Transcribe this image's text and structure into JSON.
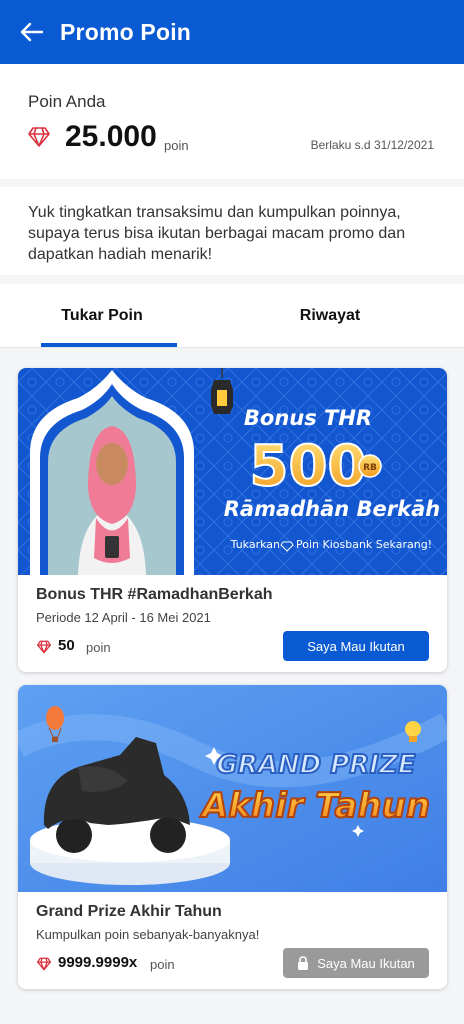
{
  "header": {
    "title": "Promo Poin",
    "back_icon": "arrow-left-icon"
  },
  "points": {
    "label": "Poin Anda",
    "value": "25.000",
    "unit": "poin",
    "expiry": "Berlaku s.d 31/12/2021",
    "gem_icon": "diamond-icon"
  },
  "info": {
    "text": "Yuk tingkatkan transaksimu dan kumpulkan poinnya, supaya terus bisa ikutan berbagai macam promo dan dapatkan hadiah menarik!"
  },
  "tabs": [
    {
      "label": "Tukar Poin",
      "active": true
    },
    {
      "label": "Riwayat",
      "active": false
    }
  ],
  "promos": [
    {
      "banner": {
        "headline": "Bonus THR",
        "amount": "500",
        "amount_unit": "RB",
        "tagline": "Rāmadhān Berkāh",
        "cta": "Tukarkan",
        "cta_rest": "Poin Kiosbank Sekarang!"
      },
      "title": "Bonus THR #RamadhanBerkah",
      "subtitle": "Periode 12 April - 16 Mei 2021",
      "points": "50",
      "points_unit": "poin",
      "button": "Saya Mau Ikutan",
      "button_enabled": true
    },
    {
      "banner": {
        "line1": "GRAND PRIZE",
        "line2": "Akhir Tahun"
      },
      "title": "Grand Prize Akhir Tahun",
      "subtitle": "Kumpulkan poin sebanyak-banyaknya!",
      "points": "9999.9999x",
      "points_unit": "poin",
      "button": "Saya Mau Ikutan",
      "button_enabled": false
    }
  ],
  "colors": {
    "primary": "#0a5bd3",
    "gem": "#d9323f",
    "disabled": "#9a9a9a"
  }
}
